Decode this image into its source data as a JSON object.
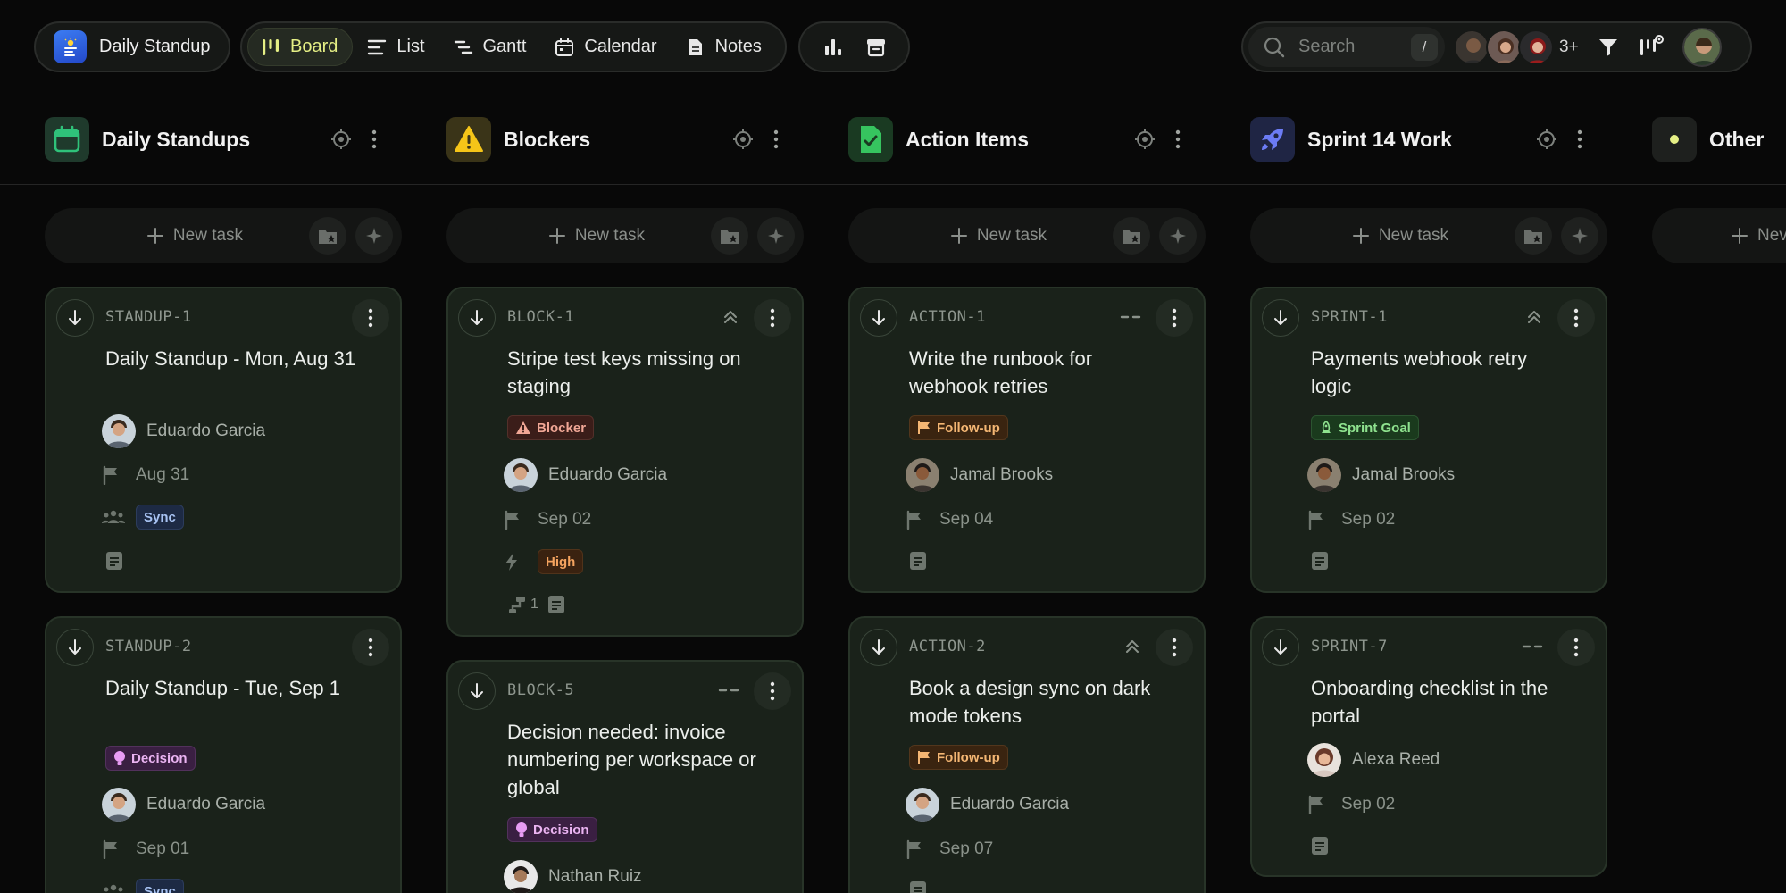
{
  "project": {
    "name": "Daily Standup"
  },
  "views": [
    {
      "label": "Board",
      "icon": "board-icon",
      "active": true
    },
    {
      "label": "List",
      "icon": "list-icon"
    },
    {
      "label": "Gantt",
      "icon": "gantt-icon"
    },
    {
      "label": "Calendar",
      "icon": "calendar-icon"
    },
    {
      "label": "Notes",
      "icon": "notes-icon"
    }
  ],
  "search": {
    "placeholder": "Search",
    "shortcut": "/"
  },
  "members": {
    "more": "3+"
  },
  "new_task_label": "New task",
  "columns": [
    {
      "title": "Daily Standups",
      "icon": "calendar-icon",
      "accent": "#2fc27a",
      "cards": [
        {
          "code": "STANDUP-1",
          "title": "Daily Standup - Mon, Aug 31",
          "assignee": "Eduardo Garcia",
          "date": "Aug 31",
          "team_tag": "Sync"
        },
        {
          "code": "STANDUP-2",
          "title": "Daily Standup - Tue, Sep 1",
          "tag": "Decision",
          "assignee": "Eduardo Garcia",
          "date": "Sep 01",
          "team_tag": "Sync"
        }
      ]
    },
    {
      "title": "Blockers",
      "icon": "warning-icon",
      "accent": "#f5c518",
      "cards": [
        {
          "code": "BLOCK-1",
          "title": "Stripe test keys missing on staging",
          "tag": "Blocker",
          "assignee": "Eduardo Garcia",
          "date": "Sep 02",
          "priority": "High",
          "subtasks": "1"
        },
        {
          "code": "BLOCK-5",
          "title": "Decision needed: invoice numbering per workspace or global",
          "tag": "Decision",
          "assignee": "Nathan Ruiz"
        }
      ]
    },
    {
      "title": "Action Items",
      "icon": "checklist-icon",
      "accent": "#36c45f",
      "cards": [
        {
          "code": "ACTION-1",
          "title": "Write the runbook for webhook retries",
          "tag": "Follow-up",
          "assignee": "Jamal Brooks",
          "date": "Sep 04"
        },
        {
          "code": "ACTION-2",
          "title": "Book a design sync on dark mode tokens",
          "tag": "Follow-up",
          "assignee": "Eduardo Garcia",
          "date": "Sep 07"
        }
      ]
    },
    {
      "title": "Sprint 14 Work",
      "icon": "rocket-icon",
      "accent": "#6c7cf5",
      "cards": [
        {
          "code": "SPRINT-1",
          "title": "Payments webhook retry logic",
          "tag": "Sprint Goal",
          "assignee": "Jamal Brooks",
          "date": "Sep 02"
        },
        {
          "code": "SPRINT-7",
          "title": "Onboarding checklist in the portal",
          "assignee": "Alexa Reed",
          "date": "Sep 02"
        }
      ]
    },
    {
      "title": "Other",
      "icon": "dot-icon",
      "accent": "#e5ef85",
      "new_task_partial": "Nev"
    }
  ]
}
